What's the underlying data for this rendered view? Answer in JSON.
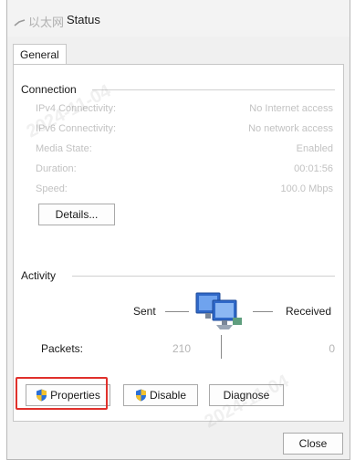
{
  "window": {
    "title_cjk": "以太网",
    "title": "Status"
  },
  "tabs": [
    {
      "label": "General"
    }
  ],
  "connection": {
    "heading": "Connection",
    "rows": [
      {
        "label": "IPv4 Connectivity:",
        "value": "No Internet access"
      },
      {
        "label": "IPv6 Connectivity:",
        "value": "No network access"
      },
      {
        "label": "Media State:",
        "value": "Enabled"
      },
      {
        "label": "Duration:",
        "value": "00:01:56"
      },
      {
        "label": "Speed:",
        "value": "100.0 Mbps"
      }
    ],
    "details_button": "Details..."
  },
  "activity": {
    "heading": "Activity",
    "sent_label": "Sent",
    "received_label": "Received",
    "packets_label": "Packets:",
    "packets_sent": "210",
    "packets_received": "0"
  },
  "buttons": {
    "properties": "Properties",
    "disable": "Disable",
    "diagnose": "Diagnose",
    "close": "Close"
  },
  "watermarks": [
    "2024-11-04",
    "2024-11-04"
  ],
  "colors": {
    "highlight": "#e0302b",
    "disabled_text": "#c2c2c2",
    "shield_blue": "#2b6fd6",
    "shield_yellow": "#f2c12e"
  },
  "icons": [
    "ethernet-icon",
    "shield-icon",
    "network-computer-icon"
  ]
}
